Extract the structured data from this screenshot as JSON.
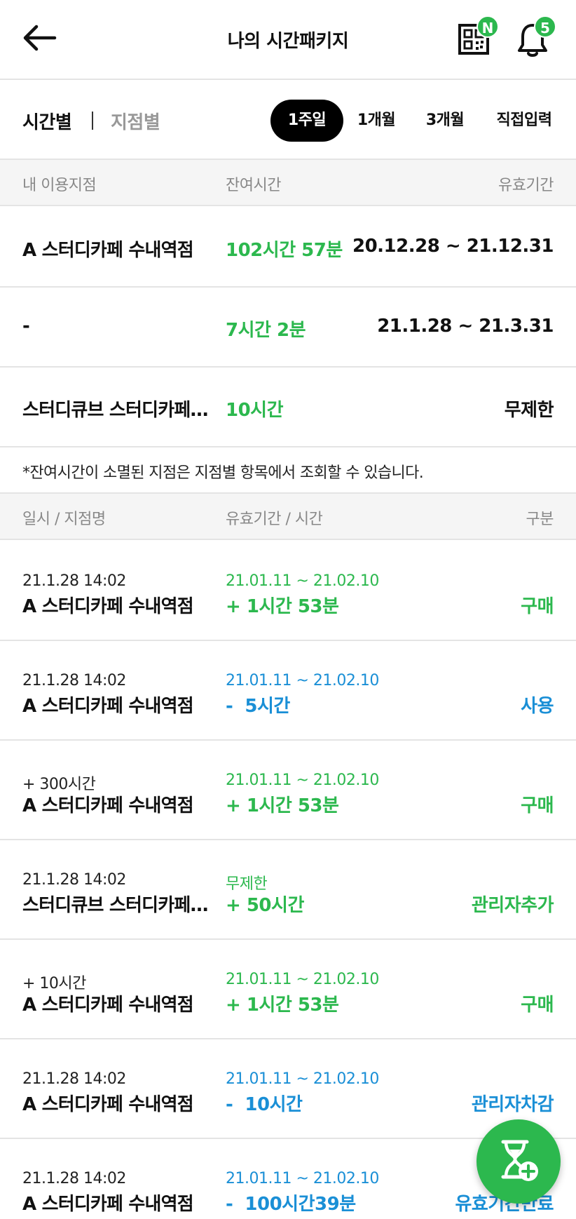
{
  "header": {
    "title": "나의 시간패키지",
    "qr_badge": "N",
    "notification_count": "5"
  },
  "filters": {
    "view_tabs": [
      {
        "label": "시간별",
        "active": true
      },
      {
        "label": "지점별",
        "active": false
      }
    ],
    "periods": [
      {
        "label": "1주일",
        "active": true
      },
      {
        "label": "1개월",
        "active": false
      },
      {
        "label": "3개월",
        "active": false
      },
      {
        "label": "직접입력",
        "active": false
      }
    ]
  },
  "summary": {
    "headers": [
      "내 이용지점",
      "잔여시간",
      "유효기간"
    ],
    "rows": [
      {
        "place": "A 스터디카페 수내역점",
        "remaining": "102시간 57분",
        "validity": "20.12.28 ~ 21.12.31"
      },
      {
        "place": "-",
        "remaining": "7시간 2분",
        "validity": "21.1.28 ~ 21.3.31"
      },
      {
        "place": "스터디큐브 스터디카페 야탑점",
        "remaining": "10시간",
        "validity": "무제한"
      }
    ],
    "note": "*잔여시간이 소멸된 지점은 지점별 항목에서 조회할 수 있습니다."
  },
  "history": {
    "headers": [
      "일시 / 지점명",
      "유효기간 / 시간",
      "구분"
    ],
    "rows": [
      {
        "sub": "21.1.28 14:02",
        "place": "A 스터디카페 수내역점",
        "period": "21.01.11 ~ 21.02.10",
        "amount": "+ 1시간 53분",
        "kind": "구매",
        "tone": "green"
      },
      {
        "sub": "21.1.28 14:02",
        "place": "A 스터디카페 수내역점",
        "period": "21.01.11 ~ 21.02.10",
        "amount": "-  5시간",
        "kind": "사용",
        "tone": "blue"
      },
      {
        "sub": "+ 300시간",
        "place": "A 스터디카페 수내역점",
        "period": "21.01.11 ~ 21.02.10",
        "amount": "+ 1시간 53분",
        "kind": "구매",
        "tone": "green"
      },
      {
        "sub": "21.1.28 14:02",
        "place": "스터디큐브 스터디카페 야탑점",
        "period": "무제한",
        "amount": "+ 50시간",
        "kind": "관리자추가",
        "tone": "green"
      },
      {
        "sub": "+ 10시간",
        "place": "A 스터디카페 수내역점",
        "period": "21.01.11 ~ 21.02.10",
        "amount": "+ 1시간 53분",
        "kind": "구매",
        "tone": "green"
      },
      {
        "sub": "21.1.28 14:02",
        "place": "A 스터디카페 수내역점",
        "period": "21.01.11 ~ 21.02.10",
        "amount": "-  10시간",
        "kind": "관리자차감",
        "tone": "blue"
      },
      {
        "sub": "21.1.28 14:02",
        "place": "A 스터디카페 수내역점",
        "period": "21.01.11 ~ 21.02.10",
        "amount": "-  100시간39분",
        "kind": "유효기간만료",
        "tone": "blue"
      }
    ]
  },
  "colors": {
    "green": "#2cb84e",
    "blue": "#1a8fd6"
  },
  "icons": [
    "back-arrow-icon",
    "qr-code-icon",
    "bell-icon",
    "hourglass-add-icon"
  ]
}
